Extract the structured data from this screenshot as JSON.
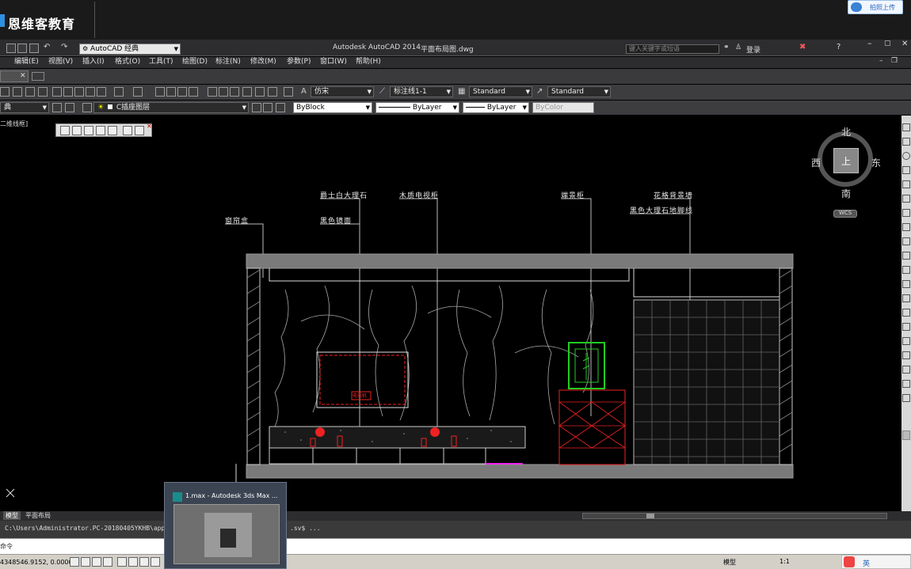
{
  "banner": {
    "logo_text": "恩维客教育",
    "upload_button": "拍照上传"
  },
  "titlebar": {
    "workspace": "AutoCAD 经典",
    "app_title": "Autodesk AutoCAD 2014",
    "file_name": "平面布局图.dwg",
    "search_placeholder": "键入关键字或短语",
    "login": "登录"
  },
  "menubar": {
    "items": [
      "编辑(E)",
      "视图(V)",
      "插入(I)",
      "格式(O)",
      "工具(T)",
      "绘图(D)",
      "标注(N)",
      "修改(M)",
      "参数(P)",
      "窗口(W)",
      "帮助(H)"
    ]
  },
  "toolbar": {
    "text_style": "仿宋",
    "dim_style": "标注线1-1",
    "table_style": "Standard",
    "mleader_style": "Standard",
    "workspace_short": "典",
    "layer": "C插座图层",
    "color": "ByBlock",
    "linetype": "ByLayer",
    "lineweight": "ByLayer",
    "plotstyle": "ByColor"
  },
  "viewport": {
    "label": "二维线框]"
  },
  "viewcube": {
    "north": "北",
    "south": "南",
    "east": "东",
    "west": "西",
    "top": "上",
    "wcs": "WCS"
  },
  "drawing": {
    "labels": {
      "curtain_box": "窗帘盒",
      "marble": "爵士白大理石",
      "black_mirror": "黑色镜面",
      "tv_cabinet": "木质电视柜",
      "display_cabinet": "端景柜",
      "flower_wall": "花格背景墙",
      "black_marble_line": "黑色大理石地脚线"
    },
    "tv_text": "电视机"
  },
  "layout_tabs": {
    "model": "模型",
    "layout": "平面布局"
  },
  "command": {
    "history": "C:\\Users\\Administrator.PC-20180405YKHB\\appd",
    "history_tail": ".sv$ ...",
    "prompt": "命令"
  },
  "statusbar": {
    "coords": "4348546.9152, 0.0000",
    "model": "模型",
    "scale": "1:1",
    "ime": "英"
  },
  "taskbar_preview": {
    "title": "1.max - Autodesk 3ds Max ..."
  }
}
